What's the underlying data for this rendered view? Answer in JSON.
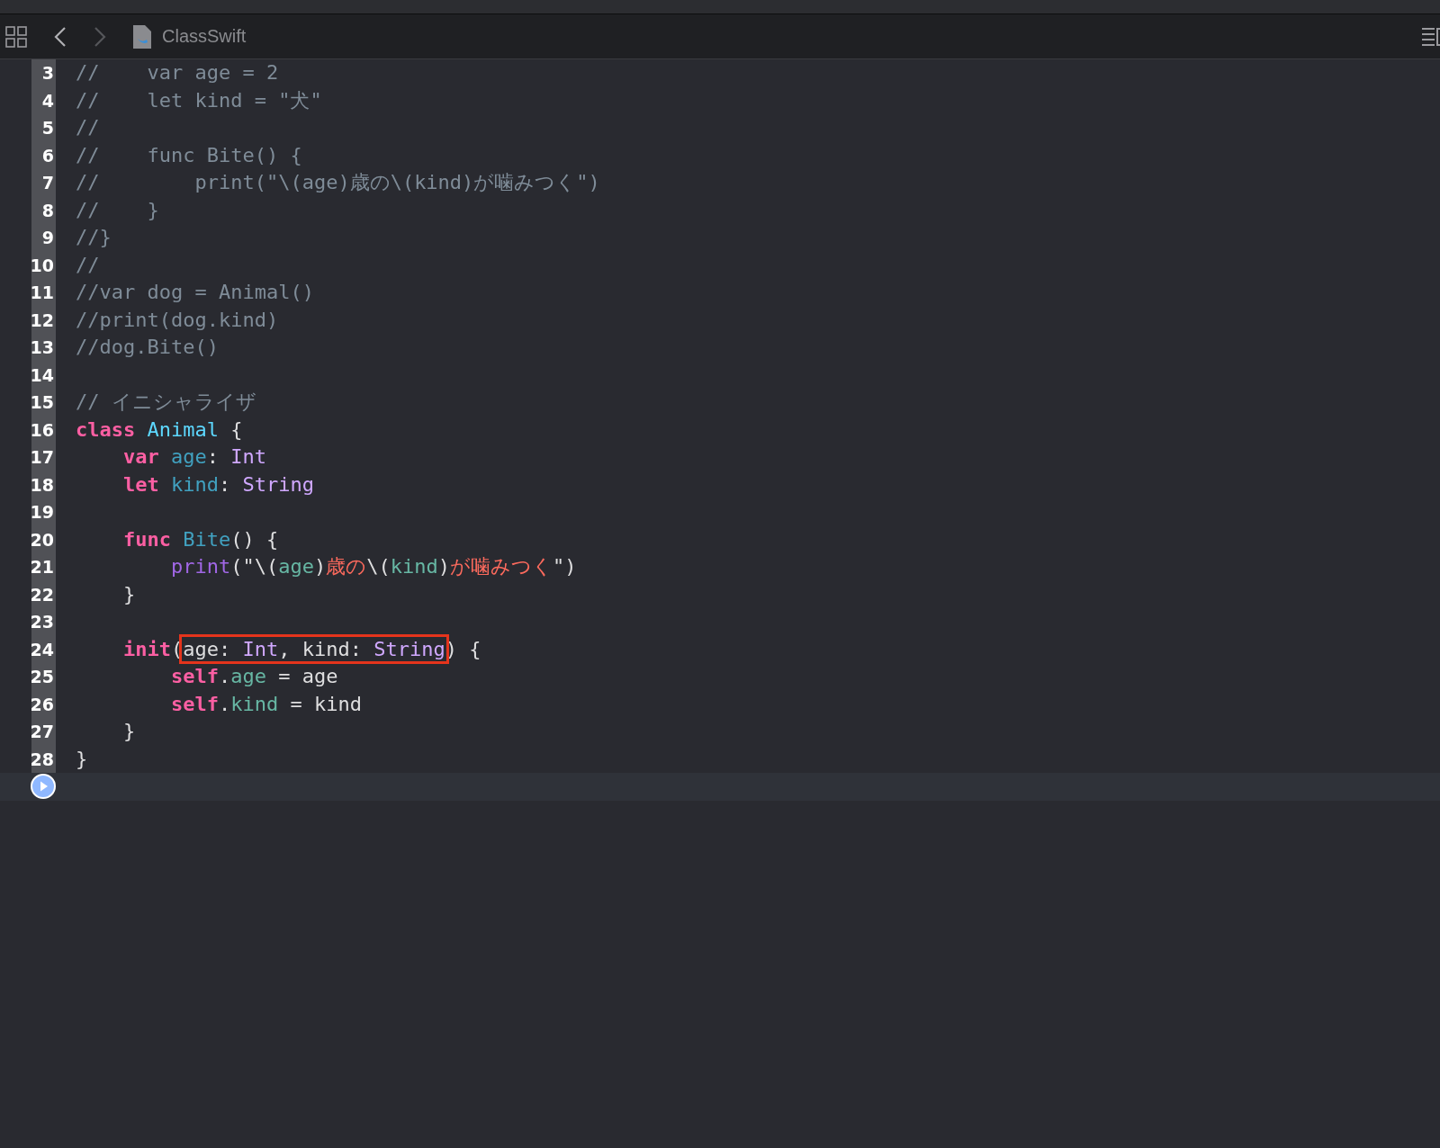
{
  "toolbar": {
    "file_name": "ClassSwift"
  },
  "lines": [
    {
      "number": "3",
      "current": false,
      "tokens": [
        {
          "kind": "comment",
          "text": "//    var age = 2"
        }
      ]
    },
    {
      "number": "4",
      "current": false,
      "tokens": [
        {
          "kind": "comment",
          "text": "//    let kind = \"犬\""
        }
      ]
    },
    {
      "number": "5",
      "current": false,
      "tokens": [
        {
          "kind": "comment",
          "text": "//"
        }
      ]
    },
    {
      "number": "6",
      "current": false,
      "tokens": [
        {
          "kind": "comment",
          "text": "//    func Bite() {"
        }
      ]
    },
    {
      "number": "7",
      "current": false,
      "tokens": [
        {
          "kind": "comment",
          "text": "//        print(\"\\(age)歳の\\(kind)が噛みつく\")"
        }
      ]
    },
    {
      "number": "8",
      "current": false,
      "tokens": [
        {
          "kind": "comment",
          "text": "//    }"
        }
      ]
    },
    {
      "number": "9",
      "current": false,
      "tokens": [
        {
          "kind": "comment",
          "text": "//}"
        }
      ]
    },
    {
      "number": "10",
      "current": false,
      "tokens": [
        {
          "kind": "comment",
          "text": "//"
        }
      ]
    },
    {
      "number": "11",
      "current": false,
      "tokens": [
        {
          "kind": "comment",
          "text": "//var dog = Animal()"
        }
      ]
    },
    {
      "number": "12",
      "current": false,
      "tokens": [
        {
          "kind": "comment",
          "text": "//print(dog.kind)"
        }
      ]
    },
    {
      "number": "13",
      "current": false,
      "tokens": [
        {
          "kind": "comment",
          "text": "//dog.Bite()"
        }
      ]
    },
    {
      "number": "14",
      "current": false
    },
    {
      "number": "15",
      "current": false,
      "tokens": [
        {
          "kind": "comment",
          "text": "// イニシャライザ"
        }
      ]
    },
    {
      "number": "16",
      "current": false,
      "tokens": [
        {
          "kind": "keyword",
          "text": "class"
        },
        {
          "kind": "classname",
          "text": " Animal"
        },
        {
          "kind": "plain",
          "text": " {"
        }
      ]
    },
    {
      "number": "17",
      "current": false,
      "tokens": [
        {
          "kind": "keyword",
          "text": "    var"
        },
        {
          "kind": "decl",
          "text": " age"
        },
        {
          "kind": "plain",
          "text": ": "
        },
        {
          "kind": "type",
          "text": "Int"
        }
      ]
    },
    {
      "number": "18",
      "current": false,
      "tokens": [
        {
          "kind": "keyword",
          "text": "    let"
        },
        {
          "kind": "decl",
          "text": " kind"
        },
        {
          "kind": "plain",
          "text": ": "
        },
        {
          "kind": "type",
          "text": "String"
        }
      ]
    },
    {
      "number": "19",
      "current": false
    },
    {
      "number": "20",
      "current": false,
      "tokens": [
        {
          "kind": "keyword",
          "text": "    func"
        },
        {
          "kind": "decl",
          "text": " Bite"
        },
        {
          "kind": "plain",
          "text": "() {"
        }
      ]
    },
    {
      "number": "21",
      "current": false,
      "tokens": [
        {
          "kind": "call",
          "text": "        print"
        },
        {
          "kind": "plain",
          "text": "(\"\\("
        },
        {
          "kind": "property",
          "text": "age"
        },
        {
          "kind": "plain",
          "text": ")"
        },
        {
          "kind": "string",
          "text": "歳の"
        },
        {
          "kind": "plain",
          "text": "\\("
        },
        {
          "kind": "property",
          "text": "kind"
        },
        {
          "kind": "plain",
          "text": ")"
        },
        {
          "kind": "string",
          "text": "が噛みつく"
        },
        {
          "kind": "plain",
          "text": "\")"
        }
      ]
    },
    {
      "number": "22",
      "current": false,
      "tokens": [
        {
          "kind": "plain",
          "text": "    }"
        }
      ]
    },
    {
      "number": "23",
      "current": false
    },
    {
      "number": "24",
      "current": false,
      "tokens": [
        {
          "kind": "keyword",
          "text": "    init"
        },
        {
          "kind": "plain",
          "text": "("
        },
        {
          "kind": "box",
          "parts": [
            {
              "kind": "plain",
              "text": "age: "
            },
            {
              "kind": "type",
              "text": "Int"
            },
            {
              "kind": "plain",
              "text": ", kind: "
            },
            {
              "kind": "type",
              "text": "String"
            }
          ]
        },
        {
          "kind": "plain",
          "text": ")"
        },
        {
          "kind": "plain",
          "text": " {"
        }
      ]
    },
    {
      "number": "25",
      "current": false,
      "tokens": [
        {
          "kind": "keyword",
          "text": "        self"
        },
        {
          "kind": "plain",
          "text": "."
        },
        {
          "kind": "property",
          "text": "age"
        },
        {
          "kind": "plain",
          "text": " = age"
        }
      ]
    },
    {
      "number": "26",
      "current": false,
      "tokens": [
        {
          "kind": "keyword",
          "text": "        self"
        },
        {
          "kind": "plain",
          "text": "."
        },
        {
          "kind": "property",
          "text": "kind"
        },
        {
          "kind": "plain",
          "text": " = kind"
        }
      ]
    },
    {
      "number": "27",
      "current": false,
      "tokens": [
        {
          "kind": "plain",
          "text": "    }"
        }
      ]
    },
    {
      "number": "28",
      "current": false,
      "tokens": [
        {
          "kind": "plain",
          "text": "}"
        }
      ]
    },
    {
      "current": true
    }
  ]
}
